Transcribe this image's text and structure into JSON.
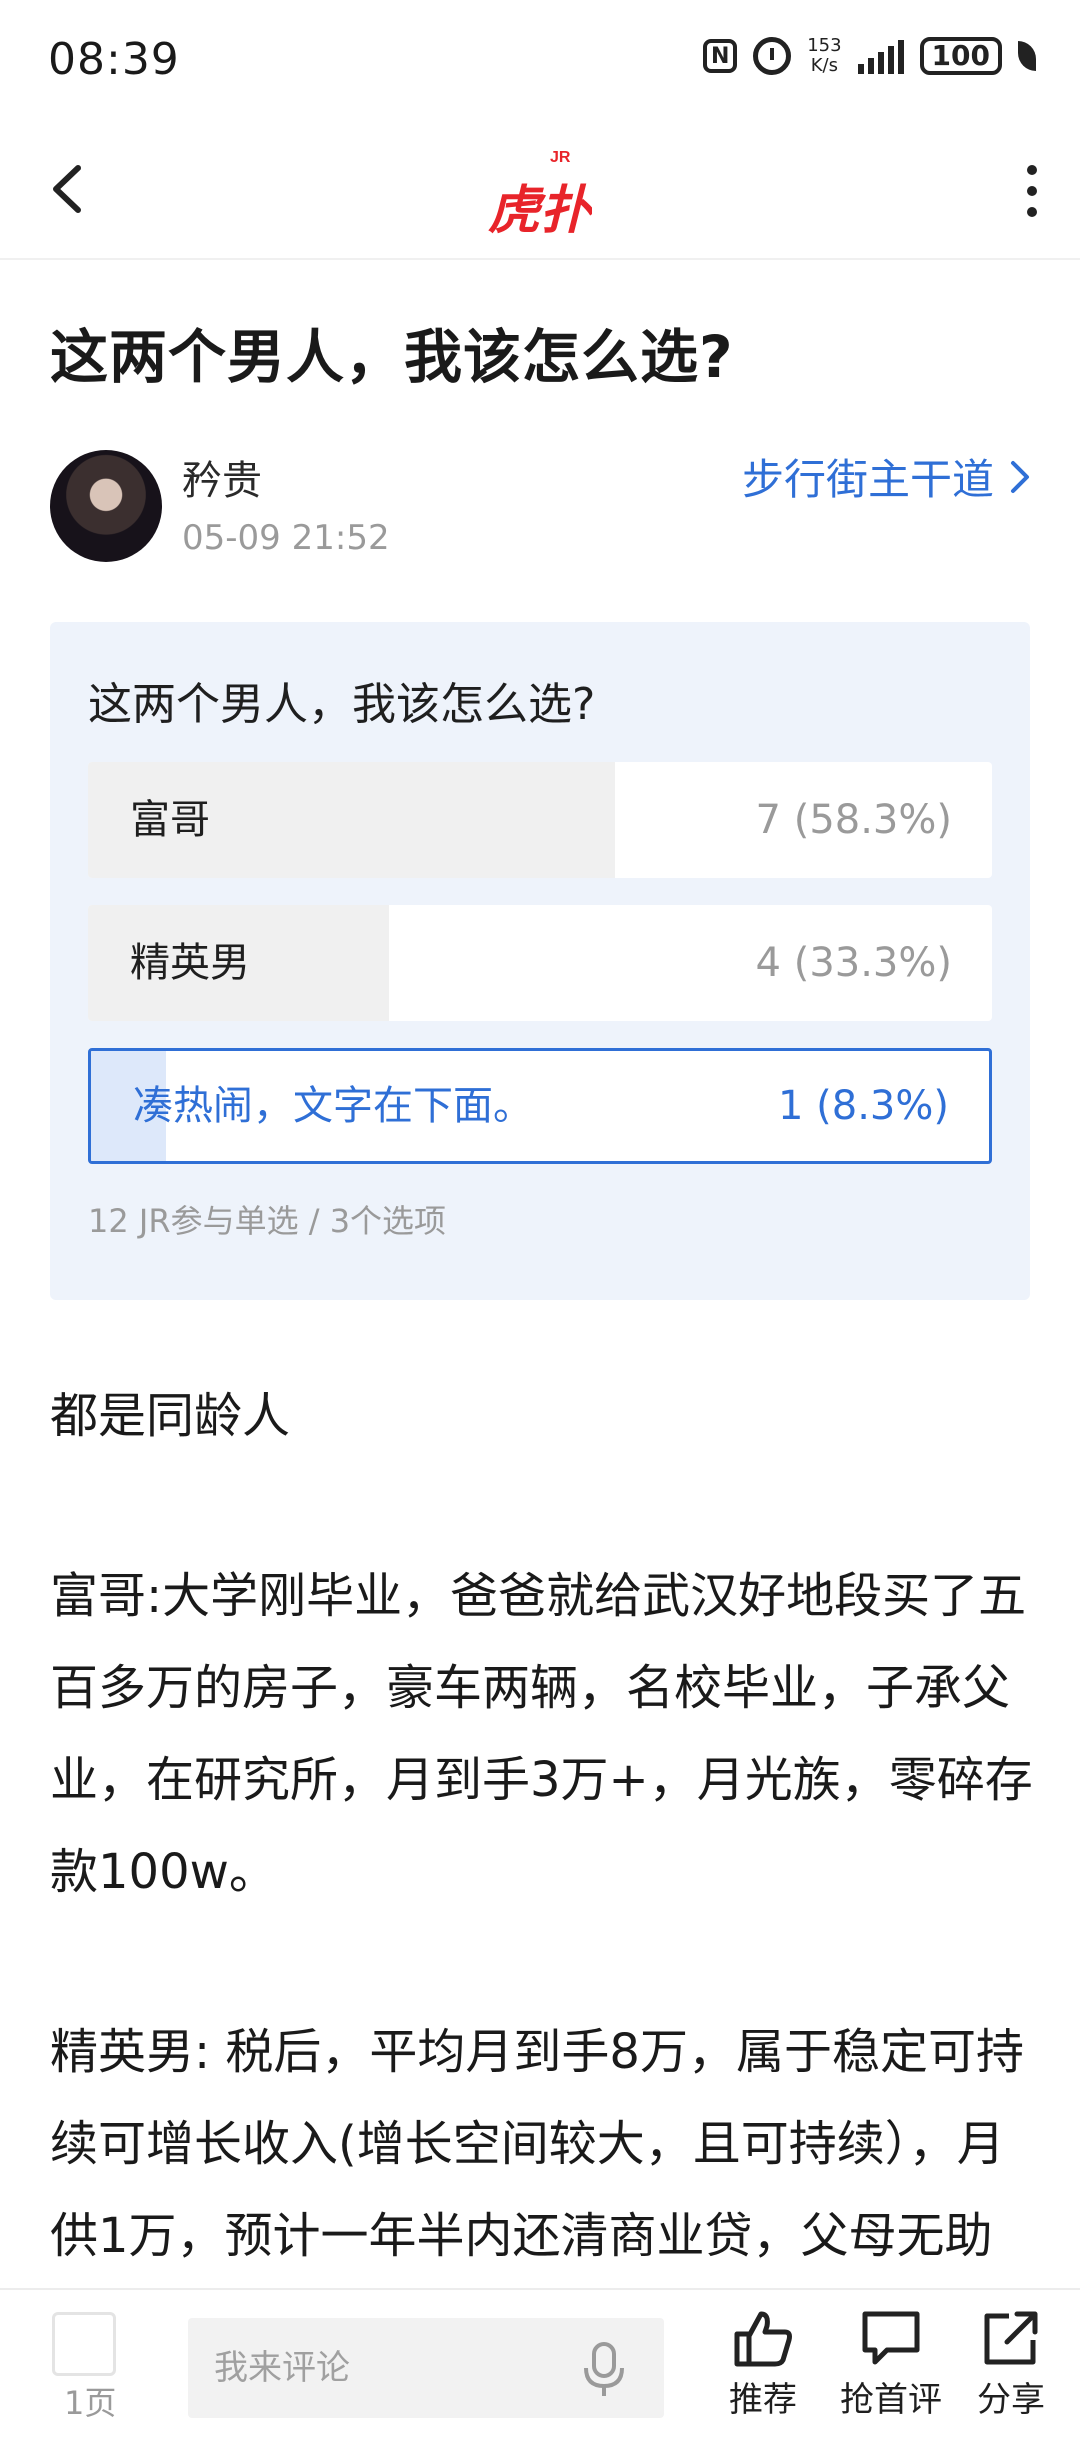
{
  "status_bar": {
    "time": "08:39",
    "nfc": "N",
    "speed_value": "153",
    "speed_unit": "K/s",
    "battery": "100",
    "icons": [
      "nfc-icon",
      "alarm-icon",
      "signal-icon",
      "battery-icon",
      "leaf-icon"
    ]
  },
  "header": {
    "logo_text": "虎扑",
    "logo_badge": "JR",
    "back_icon": "back-chevron-icon",
    "more_icon": "more-vertical-icon"
  },
  "post": {
    "title": "这两个男人，我该怎么选?",
    "author": "矜贵",
    "time": "05-09 21:52",
    "board": "步行街主干道"
  },
  "poll": {
    "question": "这两个男人，我该怎么选?",
    "options": [
      {
        "label": "富哥",
        "count": "7 (58.3%)",
        "share": 0.583,
        "selected": false
      },
      {
        "label": "精英男",
        "count": "4 (33.3%)",
        "share": 0.333,
        "selected": false
      },
      {
        "label": "凑热闹，文字在下面。",
        "count": "1 (8.3%)",
        "share": 0.083,
        "selected": true
      }
    ],
    "meta": "12 JR参与单选 / 3个选项"
  },
  "content": {
    "paragraphs": [
      "都是同龄人",
      "富哥:大学刚毕业，爸爸就给武汉好地段买了五百多万的房子，豪车两辆，名校毕业，子承父业，在研究所，月到手3万+，月光族，零碎存款100w。",
      "精英男: 税后，平均月到手8万，属于稳定可持续可增长收入(增长空间较大，且可持续），月供1万，预计一年半内还清商业贷，父母无助力，武汉大平层"
    ]
  },
  "bottom_bar": {
    "page": "1页",
    "comment_placeholder": "我来评论",
    "actions": {
      "recommend": "推荐",
      "first_comment": "抢首评",
      "share": "分享"
    },
    "colors": {
      "accent": "#2f6fd6",
      "logo": "#e8242a"
    }
  }
}
